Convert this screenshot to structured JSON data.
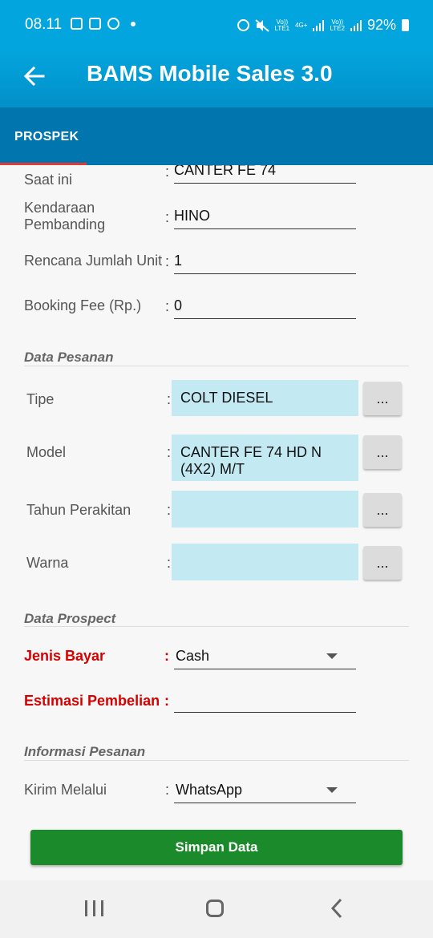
{
  "status_bar": {
    "time": "08.11",
    "sim1_label": "Vo))\nLTE1",
    "net_label": "4G+",
    "sim2_label": "Vo))\nLTE2",
    "battery": "92%"
  },
  "app_bar": {
    "title": "BAMS Mobile Sales 3.0"
  },
  "tabs": [
    {
      "label": "PROSPEK",
      "active": true
    }
  ],
  "form_top": {
    "current_label": "Saat ini",
    "current_value": "CANTER FE 74",
    "compare_label": "Kendaraan\nPembanding",
    "compare_value": "HINO",
    "units_label": "Rencana Jumlah Unit",
    "units_value": "1",
    "booking_label": "Booking Fee (Rp.)",
    "booking_value": "0",
    "colon": ":"
  },
  "order_section": {
    "title": "Data Pesanan",
    "type_label": "Tipe",
    "type_value": "COLT DIESEL",
    "model_label": "Model",
    "model_value": "CANTER FE 74 HD N (4X2) M/T",
    "year_label": "Tahun Perakitan",
    "year_value": "",
    "color_label": "Warna",
    "color_value": "",
    "picker_label": "..."
  },
  "prospect_section": {
    "title": "Data Prospect",
    "payment_label": "Jenis Bayar",
    "payment_value": "Cash",
    "estimate_label": "Estimasi Pembelian",
    "estimate_value": "",
    "colon": ":"
  },
  "info_section": {
    "title": "Informasi Pesanan",
    "send_via_label": "Kirim Melalui",
    "send_via_value": "WhatsApp"
  },
  "save_button": {
    "label": "Simpan Data"
  },
  "colors": {
    "primary": "#03a5de",
    "tab_bar": "#0175ad",
    "tab_indicator": "#e53935",
    "input_fill": "#c3eaf3",
    "required_label": "#d50000",
    "save_button": "#1b8a2a"
  },
  "icons": {
    "back": "arrow-left-icon",
    "dropdown": "caret-down-icon",
    "nav_recent": "recent-apps-icon",
    "nav_home": "home-icon",
    "nav_back": "chevron-left-icon"
  }
}
